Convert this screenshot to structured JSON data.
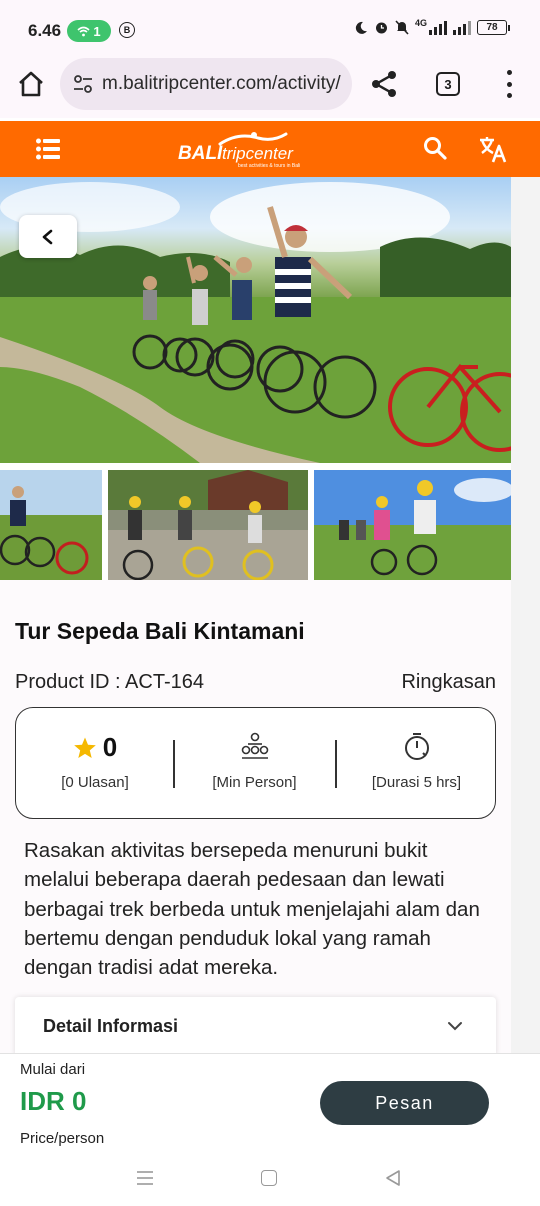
{
  "status_bar": {
    "time": "6.46",
    "wifi_badge": "1",
    "b_icon": "B",
    "network": "4G",
    "battery": "78",
    "icons": [
      "moon-icon",
      "alarm-icon",
      "mute-icon",
      "signal-icon",
      "battery-icon"
    ]
  },
  "browser": {
    "url": "m.balitripcenter.com/activity/",
    "tab_count": "3",
    "icons": [
      "home-icon",
      "tune-icon",
      "share-icon",
      "tabs-icon",
      "more-icon"
    ]
  },
  "header": {
    "logo_bali": "BALI",
    "logo_rest": "tripcenter",
    "logo_tagline": "best activities & tours in Bali",
    "icons": [
      "menu-list-icon",
      "search-icon",
      "translate-icon"
    ],
    "brand_color": "#ff6a00"
  },
  "gallery": {
    "icons": [
      "chevron-left-icon"
    ]
  },
  "product": {
    "title": "Tur Sepeda Bali Kintamani",
    "product_id": "Product ID : ACT-164",
    "summary_link": "Ringkasan",
    "rating": "0",
    "reviews": "[0 Ulasan]",
    "min_person": "[Min Person]",
    "duration": "[Durasi 5 hrs]",
    "description": "Rasakan aktivitas bersepeda menuruni bukit melalui beberapa daerah pedesaan dan lewati berbagai trek berbeda untuk menjelajahi alam dan bertemu dengan penduduk lokal yang ramah dengan tradisi adat mereka.",
    "detail_title": "Detail Informasi",
    "star_color": "#f5b800"
  },
  "booking": {
    "from_label": "Mulai dari",
    "price": "IDR 0",
    "per_label": "Price/person",
    "book_label": "Pesan",
    "price_color": "#1f9a4a"
  }
}
